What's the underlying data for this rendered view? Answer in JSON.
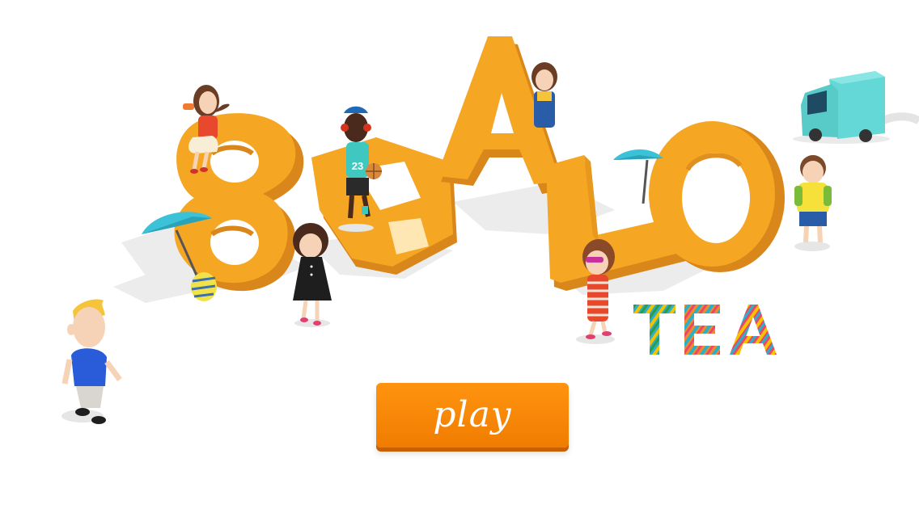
{
  "game": {
    "title_logo": "BRALO",
    "subtitle": "TEA",
    "play_label": "play",
    "jersey_number": "23"
  },
  "colors": {
    "background": "#ffffff",
    "letters": "#f5a623",
    "letters_dark": "#d9861a",
    "play_button": "#f7870a",
    "truck": "#64d8d6",
    "umbrella": "#3cc2d8"
  }
}
